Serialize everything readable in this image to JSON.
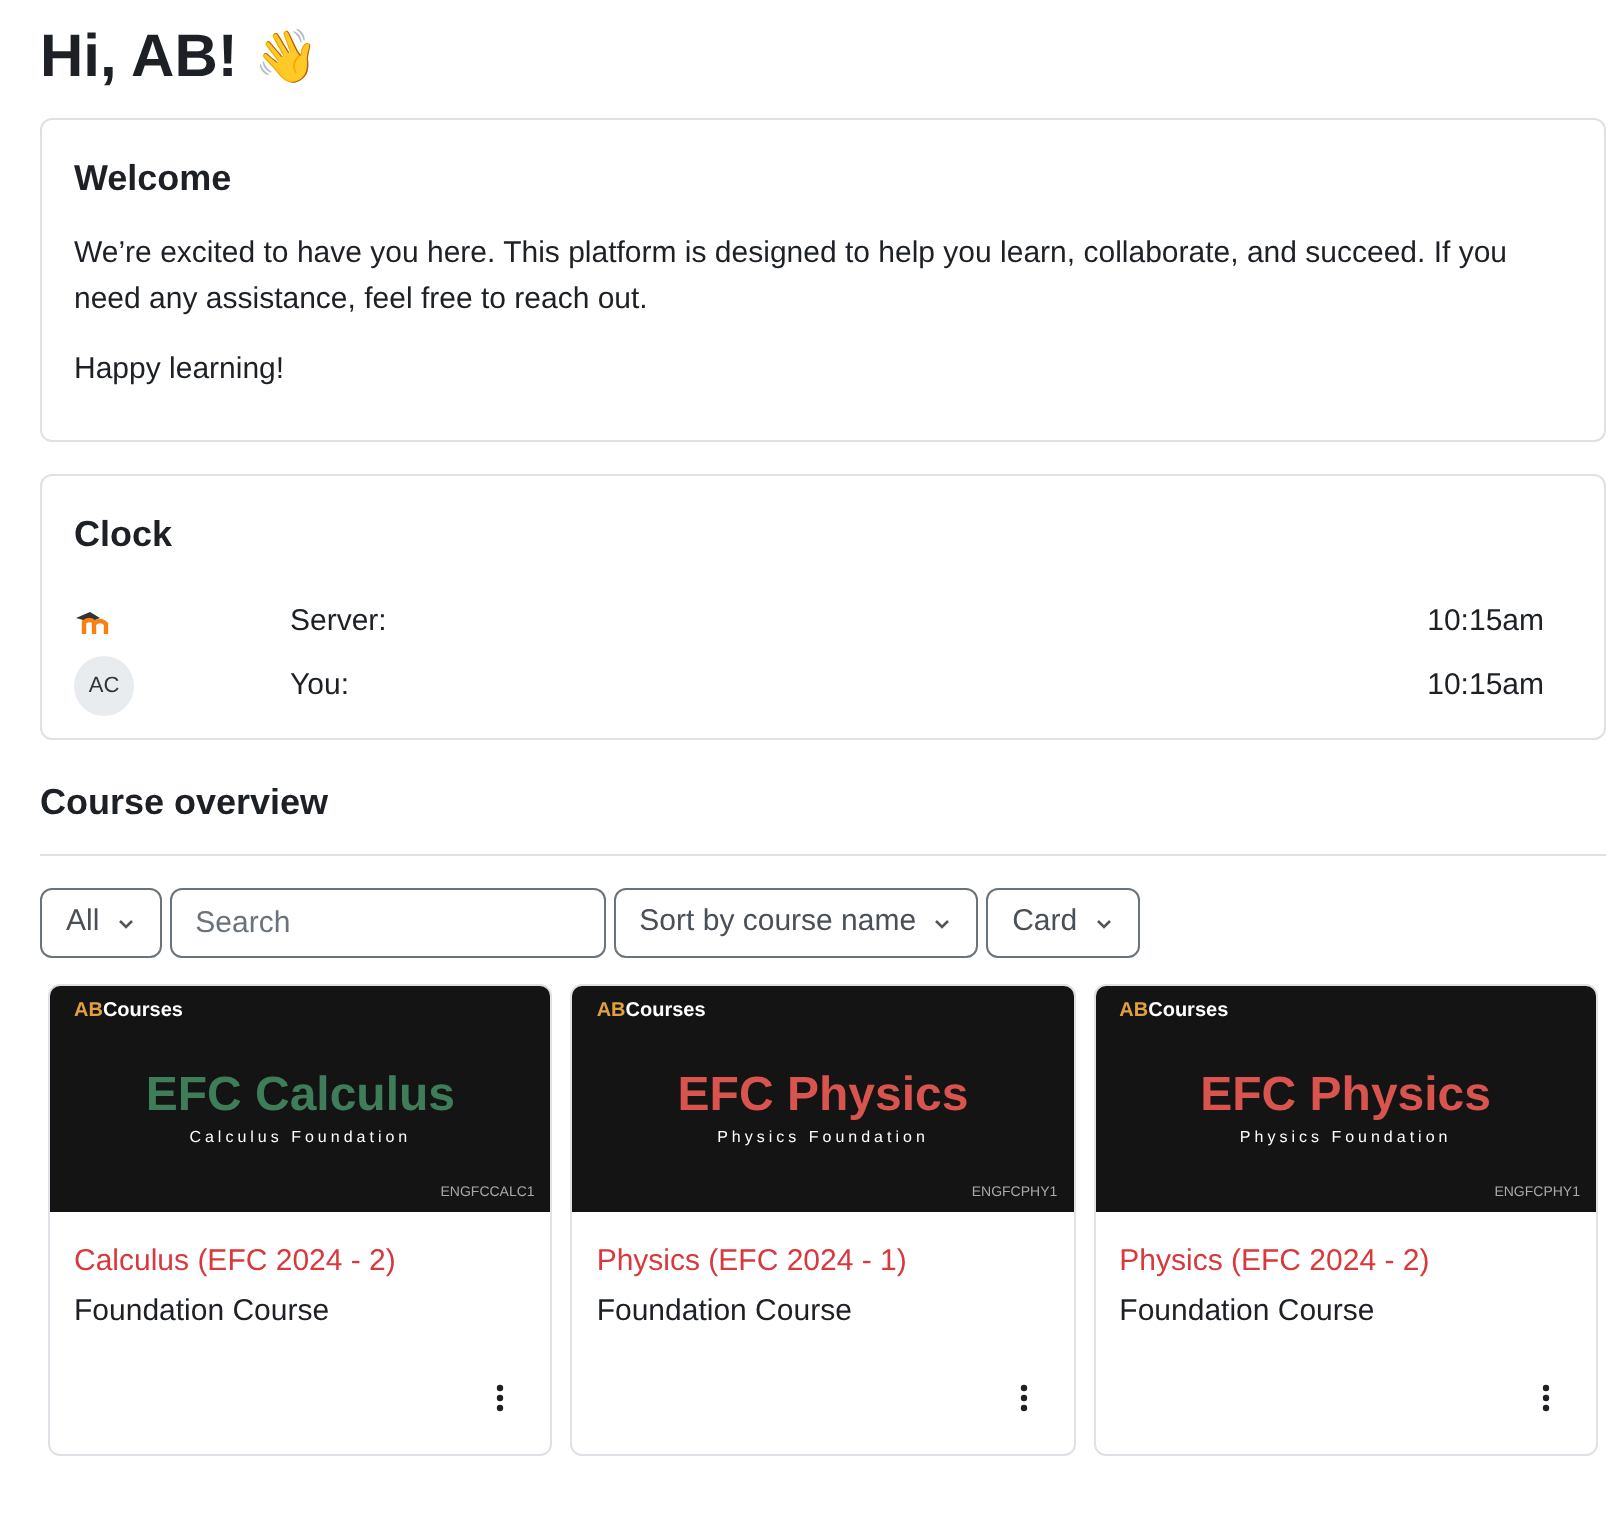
{
  "greeting": {
    "title": "Hi, AB!",
    "emoji": "👋"
  },
  "welcome": {
    "title": "Welcome",
    "paragraphs": [
      "We’re excited to have you here. This platform is designed to help you learn, collaborate, and succeed. If you need any assistance, feel free to reach out.",
      "Happy learning!"
    ]
  },
  "clock": {
    "title": "Clock",
    "rows": [
      {
        "kind": "logo",
        "label": "Server:",
        "time": "10:15am"
      },
      {
        "kind": "avatar",
        "initials": "AC",
        "label": "You:",
        "time": "10:15am"
      }
    ]
  },
  "course_overview": {
    "title": "Course overview",
    "filters": {
      "grouping": "All",
      "search_placeholder": "Search",
      "sort": "Sort by course name",
      "view": "Card"
    },
    "courses": [
      {
        "brand_a": "AB",
        "brand_b": "Courses",
        "banner_title": "EFC Calculus",
        "banner_subtitle": "Calculus Foundation",
        "code": "ENGFCCALC1",
        "color": "#3f7d5a",
        "name": "Calculus (EFC 2024 - 2)",
        "category": "Foundation Course"
      },
      {
        "brand_a": "AB",
        "brand_b": "Courses",
        "banner_title": "EFC Physics",
        "banner_subtitle": "Physics Foundation",
        "code": "ENGFCPHY1",
        "color": "#d9534f",
        "name": "Physics (EFC 2024 - 1)",
        "category": "Foundation Course"
      },
      {
        "brand_a": "AB",
        "brand_b": "Courses",
        "banner_title": "EFC Physics",
        "banner_subtitle": "Physics Foundation",
        "code": "ENGFCPHY1",
        "color": "#d9534f",
        "name": "Physics (EFC 2024 - 2)",
        "category": "Foundation Course"
      }
    ]
  }
}
